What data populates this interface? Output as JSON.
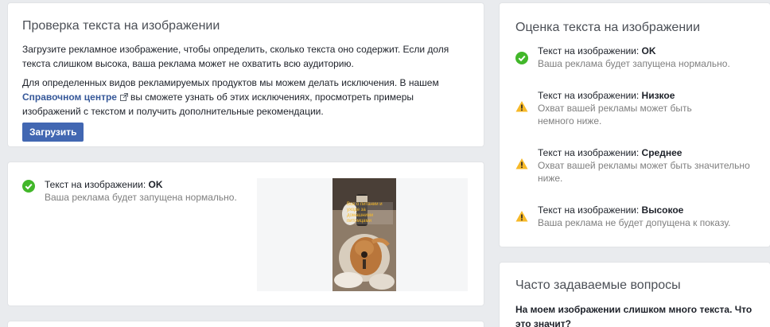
{
  "check_card": {
    "title": "Проверка текста на изображении",
    "p1": "Загрузите рекламное изображение, чтобы определить, сколько текста оно содержит. Если доля текста слишком высока, ваша реклама может не охватить всю аудиторию.",
    "p2_before": "Для определенных видов рекламируемых продуктов мы можем делать исключения. В нашем",
    "p2_link": "Справочном центре",
    "p2_after": "вы сможете узнать об этих исключениях, просмотреть примеры изображений с текстом и получить дополнительные рекомендации.",
    "upload_button": "Загрузить"
  },
  "result_card": {
    "status_label": "Текст на изображении: ",
    "status_value": "OK",
    "status_sub": "Ваша реклама будет запущена нормально.",
    "image_caption": "Все о питании и уходе за домашними питомцами"
  },
  "rating_card": {
    "title": "Оценка текста на изображении",
    "items": [
      {
        "label": "Текст на изображении: ",
        "value": "OK",
        "desc": "Ваша реклама будет запущена нормально.",
        "icon": "check-icon"
      },
      {
        "label": "Текст на изображении: ",
        "value": "Низкое",
        "desc": "Охват вашей рекламы может быть немного ниже.",
        "icon": "warning-icon"
      },
      {
        "label": "Текст на изображении: ",
        "value": "Среднее",
        "desc": "Охват вашей рекламы может быть значительно ниже.",
        "icon": "warning-icon"
      },
      {
        "label": "Текст на изображении: ",
        "value": "Высокое",
        "desc": "Ваша реклама не будет допущена к показу.",
        "icon": "warning-icon"
      }
    ]
  },
  "faq_card": {
    "title": "Часто задаваемые вопросы",
    "q1": "На моем изображении слишком много текста. Что это значит?"
  },
  "colors": {
    "background": "#e9ebee",
    "accent": "#4267b2",
    "link": "#365899",
    "ok": "#42b72a",
    "warning": "#f7b928"
  }
}
